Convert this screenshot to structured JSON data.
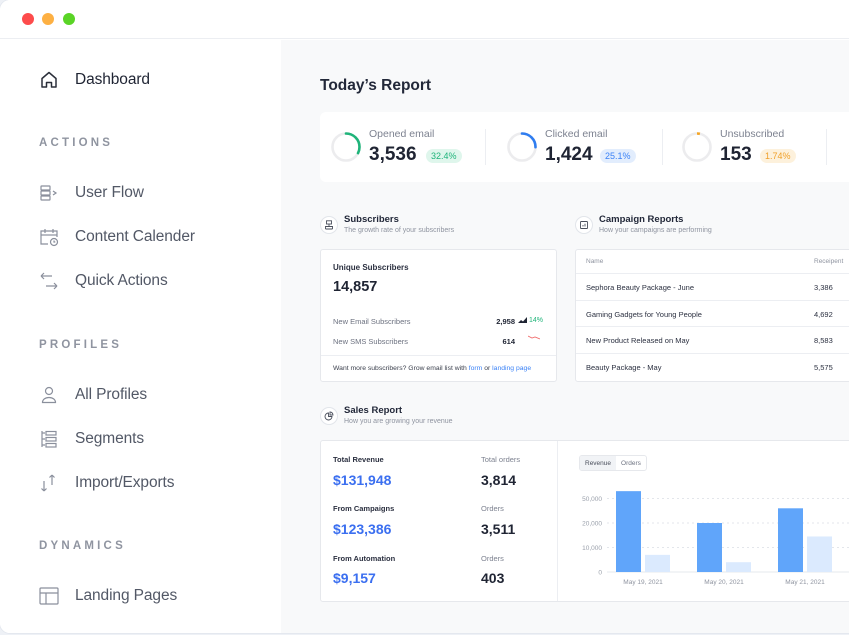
{
  "window": {
    "controls": [
      "close",
      "minimize",
      "maximize"
    ]
  },
  "sidebar": {
    "top_item": {
      "label": "Dashboard",
      "icon": "home-icon",
      "active": true
    },
    "sections": [
      {
        "title": "ACTIONS",
        "items": [
          {
            "label": "User Flow",
            "icon": "user-flow-icon"
          },
          {
            "label": "Content Calender",
            "icon": "calendar-clock-icon"
          },
          {
            "label": "Quick Actions",
            "icon": "arrows-exchange-icon"
          }
        ]
      },
      {
        "title": "PROFILES",
        "items": [
          {
            "label": "All Profiles",
            "icon": "user-icon"
          },
          {
            "label": "Segments",
            "icon": "segments-icon"
          },
          {
            "label": "Import/Exports",
            "icon": "arrows-up-down-icon"
          }
        ]
      },
      {
        "title": "DYNAMICS",
        "items": [
          {
            "label": "Landing Pages",
            "icon": "layout-icon"
          }
        ]
      }
    ]
  },
  "main": {
    "title": "Today’s Report",
    "stats": [
      {
        "name": "Opened email",
        "value": "3,536",
        "badge": "32.4%",
        "progress": 0.324,
        "color": "#1fb47a",
        "badge_bg": "#dff6ec",
        "badge_color": "#1fb47a"
      },
      {
        "name": "Clicked email",
        "value": "1,424",
        "badge": "25.1%",
        "progress": 0.251,
        "color": "#2f7df0",
        "badge_bg": "#e2edfd",
        "badge_color": "#3b82f6"
      },
      {
        "name": "Unsubscribed",
        "value": "153",
        "badge": "1.74%",
        "progress": 0.0174,
        "color": "#f5a524",
        "badge_bg": "#fdf1dc",
        "badge_color": "#f0a02a"
      }
    ],
    "subscribers": {
      "title": "Subscribers",
      "subtitle": "The growth rate of your subscribers",
      "card_label": "Unique Subscribers",
      "total": "14,857",
      "rows": [
        {
          "label": "New Email Subscribers",
          "value": "2,958",
          "trend": "14%",
          "direction": "up"
        },
        {
          "label": "New SMS Subscribers",
          "value": "614",
          "trend": "",
          "direction": "down"
        }
      ],
      "footer_text": "Want more subscribers? Grow email list with ",
      "footer_link1": "form",
      "footer_mid": " or ",
      "footer_link2": "landing page"
    },
    "campaigns": {
      "title": "Campaign Reports",
      "subtitle": "How your campaigns are performing",
      "columns": [
        "Name",
        "Receipent"
      ],
      "rows": [
        {
          "name": "Sephora Beauty Package - June",
          "recipients": "3,386"
        },
        {
          "name": "Gaming Gadgets for Young People",
          "recipients": "4,692"
        },
        {
          "name": "New Product Released on May",
          "recipients": "8,583"
        },
        {
          "name": "Beauty Package - May",
          "recipients": "5,575"
        }
      ]
    },
    "sales": {
      "title": "Sales Report",
      "subtitle": "How you are growing your revenue",
      "metrics": [
        {
          "label": "Total Revenue",
          "value": "$131,948",
          "orders_label": "Total orders",
          "orders": "3,814"
        },
        {
          "label": "From Campaigns",
          "value": "$123,386",
          "orders_label": "Orders",
          "orders": "3,511"
        },
        {
          "label": "From Automation",
          "value": "$9,157",
          "orders_label": "Orders",
          "orders": "403"
        }
      ],
      "toggle": {
        "options": [
          "Revenue",
          "Orders"
        ],
        "selected": "Revenue"
      }
    }
  },
  "chart_data": {
    "type": "bar",
    "title": "",
    "xlabel": "",
    "ylabel": "",
    "categories": [
      "May 19, 2021",
      "May 20, 2021",
      "May 21, 2021"
    ],
    "y_ticks": [
      "0",
      "10,000",
      "20,000",
      "50,000"
    ],
    "tick_levels": [
      0,
      1,
      2,
      3
    ],
    "series": [
      {
        "name": "primary",
        "color": "#60a5fa",
        "levels": [
          3.3,
          2.0,
          2.6
        ]
      },
      {
        "name": "secondary",
        "color": "#dbeafe",
        "levels": [
          0.7,
          0.4,
          1.45
        ]
      }
    ],
    "grid": true,
    "legend": "none"
  }
}
